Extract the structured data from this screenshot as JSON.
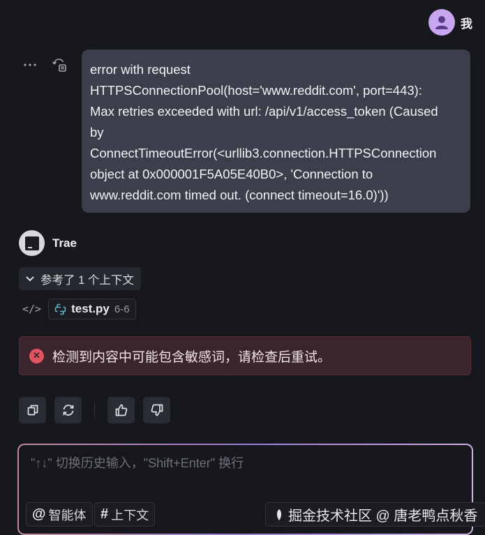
{
  "user": {
    "name": "我"
  },
  "message": {
    "lines": [
      "error with request",
      "HTTPSConnectionPool(host='www.reddit.com', port=443):",
      "Max retries exceeded with url: /api/v1/access_token (Caused",
      "by",
      "ConnectTimeoutError(<urllib3.connection.HTTPSConnection",
      "object at 0x000001F5A05E40B0>, 'Connection to",
      "www.reddit.com timed out. (connect timeout=16.0)'))"
    ],
    "actions": [
      {
        "icon": "more-horizontal-icon",
        "glyph": "···"
      },
      {
        "icon": "rerun-icon",
        "glyph": "⟲"
      }
    ]
  },
  "assistant": {
    "name": "Trae",
    "context_label": "参考了 1 个上下文",
    "file": {
      "name": "test.py",
      "lines": "6-6"
    },
    "error": "检测到内容中可能包含敏感词，请检查后重试。"
  },
  "feedback": [
    {
      "name": "copy-button",
      "icon": "copy-icon"
    },
    {
      "name": "regenerate-button",
      "icon": "refresh-icon"
    },
    {
      "name": "like-button",
      "icon": "thumbs-up-icon"
    },
    {
      "name": "dislike-button",
      "icon": "thumbs-down-icon"
    }
  ],
  "input": {
    "placeholder": "\"↑↓\" 切换历史输入，\"Shift+Enter\" 换行",
    "agent_chip": "智能体",
    "agent_symbol": "@",
    "context_chip": "上下文",
    "context_symbol": "#",
    "watermark": "掘金技术社区 @ 唐老鸭点秋香"
  },
  "colors": {
    "background": "#17181d",
    "bubble": "#3a3f4b",
    "error_bg": "#3b242b",
    "error_icon": "#e0555f",
    "user_avatar": "#c9a6f0"
  }
}
